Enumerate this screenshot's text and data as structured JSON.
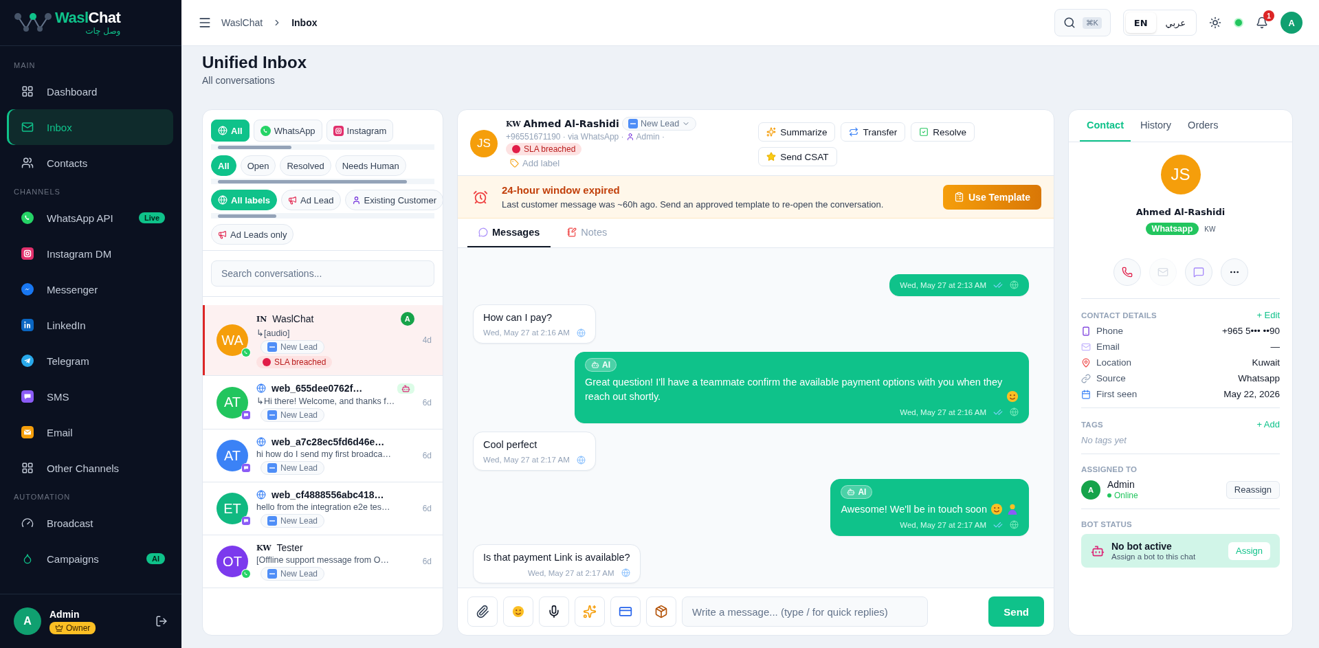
{
  "sidebar": {
    "brand": {
      "primary": "Wasl",
      "secondary": "Chat",
      "tagline": "وصل چات"
    },
    "sections": [
      {
        "title": "MAIN",
        "items": [
          {
            "kind": "dashboard",
            "label": "Dashboard",
            "selected": false
          },
          {
            "kind": "inbox",
            "label": "Inbox",
            "selected": true
          },
          {
            "kind": "contacts",
            "label": "Contacts",
            "selected": false
          }
        ]
      },
      {
        "title": "CHANNELS",
        "items": [
          {
            "kind": "whatsapp",
            "label": "WhatsApp API",
            "selected": false,
            "badge": "Live"
          },
          {
            "kind": "instagram",
            "label": "Instagram DM",
            "selected": false
          },
          {
            "kind": "messenger",
            "label": "Messenger",
            "selected": false
          },
          {
            "kind": "linkedin",
            "label": "LinkedIn",
            "selected": false
          },
          {
            "kind": "telegram",
            "label": "Telegram",
            "selected": false
          },
          {
            "kind": "sms",
            "label": "SMS",
            "selected": false
          },
          {
            "kind": "email",
            "label": "Email",
            "selected": false
          },
          {
            "kind": "other",
            "label": "Other Channels",
            "selected": false
          }
        ]
      },
      {
        "title": "AUTOMATION",
        "items": [
          {
            "kind": "broadcast",
            "label": "Broadcast",
            "selected": false
          },
          {
            "kind": "campaigns",
            "label": "Campaigns",
            "selected": false,
            "badge": "AI"
          }
        ]
      }
    ],
    "user": {
      "initial": "A",
      "name": "Admin",
      "role": "Owner"
    }
  },
  "topbar": {
    "breadcrumb": [
      "WaslChat",
      "Inbox"
    ],
    "shortcut": "⌘K",
    "languages": [
      {
        "label": "EN",
        "selected": true
      },
      {
        "label": "عربي",
        "selected": false
      }
    ],
    "online": true,
    "notifications": "1",
    "avatar": "A"
  },
  "page": {
    "title": "Unified Inbox",
    "subtitle": "All conversations"
  },
  "conversation_list": {
    "channel_filters": [
      {
        "kind": "all",
        "label": "All",
        "selected": true
      },
      {
        "kind": "whatsapp",
        "label": "WhatsApp",
        "selected": false
      },
      {
        "kind": "instagram",
        "label": "Instagram",
        "selected": false
      }
    ],
    "status_filters": [
      {
        "label": "All",
        "selected": true
      },
      {
        "label": "Open",
        "selected": false
      },
      {
        "label": "Resolved",
        "selected": false
      },
      {
        "label": "Needs Human",
        "selected": false
      }
    ],
    "label_filters": [
      {
        "kind": "all",
        "label": "All labels",
        "selected": true
      },
      {
        "kind": "ad",
        "label": "Ad Lead",
        "selected": false
      },
      {
        "kind": "customer",
        "label": "Existing Customer",
        "selected": false
      }
    ],
    "ad_leads_only": {
      "label": "Ad Leads only",
      "on": false
    },
    "search": {
      "placeholder": "Search conversations..."
    },
    "conversations": [
      {
        "initials": "WA",
        "color": "#f59e0b",
        "kind": "whatsapp",
        "prefix": "IN",
        "name": "WaslChat",
        "preview": "↳[audio]",
        "tags": [
          "New Lead"
        ],
        "sla": "SLA breached",
        "time": "4d",
        "assignee": "A",
        "bot": false,
        "selected": true
      },
      {
        "initials": "AT",
        "color": "#22c55e",
        "kind": "sms",
        "name": "web_655dee0762f…",
        "preview": "↳Hi there! Welcome, and thanks f…",
        "tags": [
          "New Lead"
        ],
        "time": "6d",
        "bot": true,
        "selected": false
      },
      {
        "initials": "AT",
        "color": "#3b82f6",
        "kind": "sms",
        "name": "web_a7c28ec5fd6d46e…",
        "preview": "hi how do I send my first broadca…",
        "tags": [
          "New Lead"
        ],
        "time": "6d",
        "bot": false,
        "selected": false
      },
      {
        "initials": "ET",
        "color": "#10b981",
        "kind": "sms",
        "name": "web_cf4888556abc418…",
        "preview": "hello from the integration e2e tes…",
        "tags": [
          "New Lead"
        ],
        "time": "6d",
        "bot": false,
        "selected": false
      },
      {
        "initials": "OT",
        "color": "#7c3aed",
        "kind": "whatsapp",
        "prefix": "KW",
        "name": "Tester",
        "preview": "[Offline support message from O…",
        "tags": [
          "New Lead"
        ],
        "time": "6d",
        "bot": false,
        "selected": false
      }
    ]
  },
  "chat": {
    "contact": {
      "initials": "JS",
      "country": "KW",
      "name": "Ahmed Al-Rashidi",
      "stage": "New Lead",
      "meta": "+96551671190 · via WhatsApp ·",
      "assignee": "Admin ·",
      "sla": "SLA breached",
      "add_label": "Add label"
    },
    "actions": [
      {
        "kind": "summarize",
        "label": "Summarize"
      },
      {
        "kind": "transfer",
        "label": "Transfer"
      },
      {
        "kind": "resolve",
        "label": "Resolve"
      },
      {
        "kind": "csat",
        "label": "Send CSAT"
      }
    ],
    "banner": {
      "title": "24-hour window expired",
      "text": "Last customer message was ~60h ago. Send an approved template to re-open the conversation.",
      "button": "Use Template"
    },
    "tabs": [
      {
        "kind": "messages",
        "label": "Messages",
        "selected": true
      },
      {
        "kind": "notes",
        "label": "Notes",
        "selected": false
      }
    ],
    "messages": [
      {
        "kind": "out",
        "time": "Wed, May 27 at 2:13 AM"
      },
      {
        "kind": "in",
        "text": "How can I pay?",
        "time": "Wed, May 27 at 2:16 AM"
      },
      {
        "kind": "out",
        "badge": "AI",
        "text": "Great question! I'll have a teammate confirm the available payment options with you when they reach out shortly.",
        "emojis": [
          {
            "kind": "smile"
          }
        ],
        "time": "Wed, May 27 at 2:16 AM"
      },
      {
        "kind": "in",
        "text": "Cool perfect",
        "time": "Wed, May 27 at 2:17 AM"
      },
      {
        "kind": "out",
        "badge": "AI",
        "text": "Awesome! We'll be in touch soon",
        "emojis": [
          {
            "kind": "smile"
          },
          {
            "kind": "pray"
          }
        ],
        "time": "Wed, May 27 at 2:17 AM"
      },
      {
        "kind": "in",
        "text": "Is that payment Link is available?",
        "time": "Wed, May 27 at 2:17 AM"
      }
    ],
    "composer": {
      "tools": [
        {
          "kind": "attach"
        },
        {
          "kind": "emoji"
        },
        {
          "kind": "voice"
        },
        {
          "kind": "ai"
        },
        {
          "kind": "payment"
        },
        {
          "kind": "product"
        }
      ],
      "placeholder": "Write a message... (type / for quick replies)",
      "send": "Send"
    }
  },
  "contact_panel": {
    "tabs": [
      {
        "label": "Contact",
        "selected": true
      },
      {
        "label": "History",
        "selected": false
      },
      {
        "label": "Orders",
        "selected": false
      }
    ],
    "initials": "JS",
    "name": "Ahmed Al-Rashidi",
    "channel": "Whatsapp",
    "country": "KW",
    "quick_actions": [
      {
        "kind": "call",
        "disabled": false
      },
      {
        "kind": "email",
        "disabled": true
      },
      {
        "kind": "chat",
        "disabled": false
      },
      {
        "kind": "more",
        "disabled": false
      }
    ],
    "details": {
      "title": "CONTACT DETAILS",
      "action": "+ Edit",
      "rows": [
        {
          "kind": "phone",
          "label": "Phone",
          "value": "+965 5••• ••90"
        },
        {
          "kind": "email",
          "label": "Email",
          "value": "—"
        },
        {
          "kind": "location",
          "label": "Location",
          "value": "Kuwait"
        },
        {
          "kind": "source",
          "label": "Source",
          "value": "Whatsapp"
        },
        {
          "kind": "calendar",
          "label": "First seen",
          "value": "May 22, 2026"
        }
      ]
    },
    "tags": {
      "title": "TAGS",
      "action": "+ Add",
      "empty": "No tags yet"
    },
    "assigned": {
      "title": "ASSIGNED TO",
      "initial": "A",
      "name": "Admin",
      "status": "Online",
      "button": "Reassign"
    },
    "bot": {
      "title": "BOT STATUS",
      "name": "No bot active",
      "hint": "Assign a bot to this chat",
      "button": "Assign"
    }
  }
}
